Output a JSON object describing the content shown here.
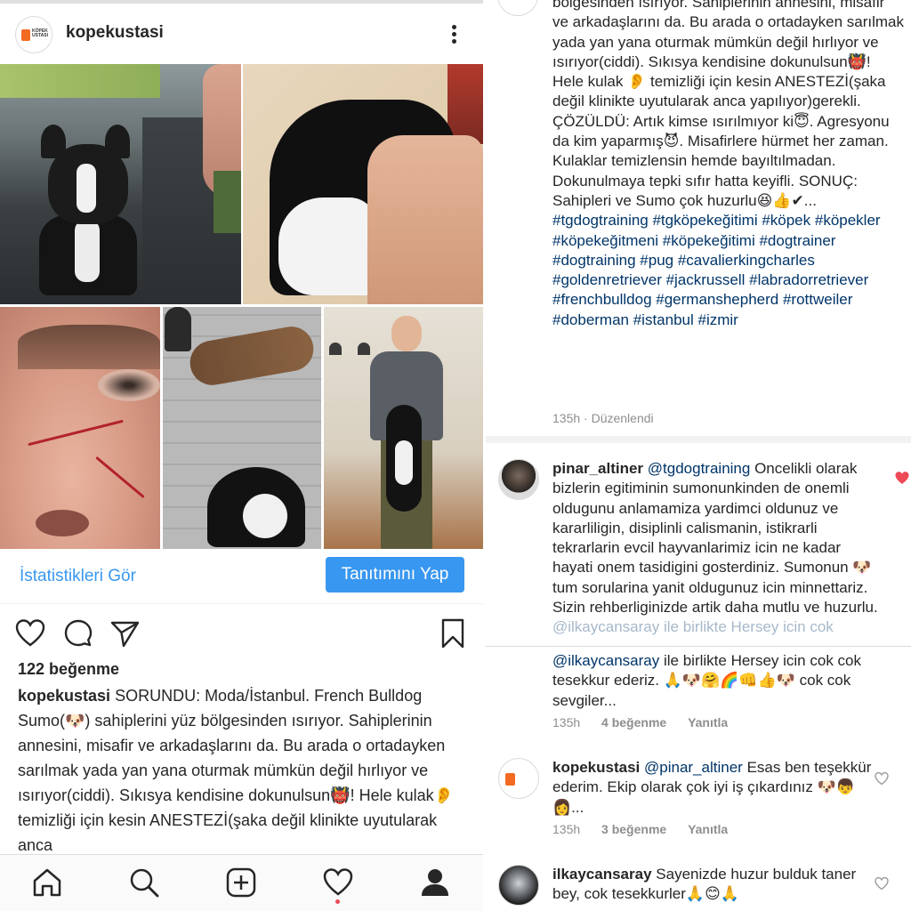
{
  "post": {
    "username": "kopekustasi",
    "avatar_text": "KÖPEK USTASI",
    "insights_label": "İstatistikleri Gör",
    "promote_label": "Tanıtımını Yap",
    "likes": "122 beğenme",
    "caption_user": "kopekustasi",
    "caption_text": "SORUNDU: Moda/İstanbul. French Bulldog Sumo(🐶) sahiplerini yüz bölgesinden ısırıyor. Sahiplerinin annesini, misafir ve arkadaşlarını da. Bu arada o ortadayken sarılmak yada yan yana oturmak mümkün değil hırlıyor ve ısırıyor(ciddi). Sıkısya kendisine dokunulsun👹! Hele kulak👂 temizliği için kesin ANESTEZİ(şaka değil klinikte uyutularak anca"
  },
  "icons": {
    "more": "more-vertical-icon",
    "like": "heart-icon",
    "comment": "comment-icon",
    "share": "send-icon",
    "save": "bookmark-icon",
    "nav_home": "home-icon",
    "nav_search": "search-icon",
    "nav_add": "add-post-icon",
    "nav_activity": "heart-icon",
    "nav_profile": "profile-icon"
  },
  "colors": {
    "accent": "#3897f0",
    "hashtag": "#003569",
    "meta": "#8e8e8e",
    "like_red": "#ed4956"
  },
  "right_caption": {
    "text": "bölgesinden ısırıyor. Sahiplerinin annesini, misafir ve arkadaşlarını da. Bu arada o ortadayken sarılmak yada yan yana oturmak mümkün değil hırlıyor ve ısırıyor(ciddi). Sıkısya kendisine dokunulsun👹! Hele kulak 👂 temizliği için kesin ANESTEZİ(şaka değil klinikte uyutularak anca yapılıyor)gerekli. ÇÖZÜLDÜ: Artık kimse ısırılmıyor ki😇. Agresyonu da kim yaparmış😈. Misafirlere hürmet her zaman. Kulaklar temizlensin hemde bayıltılmadan. Dokunulmaya tepki sıfır hatta keyifli. SONUÇ: Sahipleri ve Sumo çok huzurlu😆👍✔...",
    "hashtags": "#tgdogtraining #tgköpekeğitimi #köpek #köpekler #köpekeğitmeni #köpekeğitimi #dogtrainer #dogtraining #pug #cavalierkingcharles #goldenretriever #jackrussell #labradorretriever #frenchbulldog #germanshepherd #rottweiler #doberman #istanbul #izmir",
    "meta": "135h · Düzenlendi"
  },
  "comments": [
    {
      "user": "pinar_altiner",
      "mention": "@tgdogtraining",
      "text": "Oncelikli olarak bizlerin egitiminin sumonunkinden de onemli oldugunu anlamamiza yardimci oldunuz ve kararliligin, disiplinli calismanin, istikrarli tekrarlarin evcil hayvanlarimiz icin ne kadar hayati onem tasidigini gosterdiniz. Sumonun 🐶 tum sorularina yanit oldugunuz icin minnettariz. Sizin rehberliginizde artik daha mutlu ve huzurlu.",
      "overflow_text": "@ilkaycansaray ile birlikte Hersey icin cok",
      "cont_mention": "@ilkaycansaray",
      "cont_text": "ile birlikte Hersey icin cok cok tesekkur ederiz. 🙏🐶🤗🌈👊👍🐶 cok cok sevgiler...",
      "time": "135h",
      "likes": "4 beğenme",
      "reply": "Yanıtla"
    },
    {
      "user": "kopekustasi",
      "mention": "@pinar_altiner",
      "text": "Esas ben teşekkür ederim. Ekip olarak çok iyi iş çıkardınız 🐶👦👩...",
      "time": "135h",
      "likes": "3 beğenme",
      "reply": "Yanıtla"
    },
    {
      "user": "ilkaycansaray",
      "text": "Sayenizde huzur bulduk taner bey, cok tesekkurler🙏😊🙏"
    }
  ]
}
